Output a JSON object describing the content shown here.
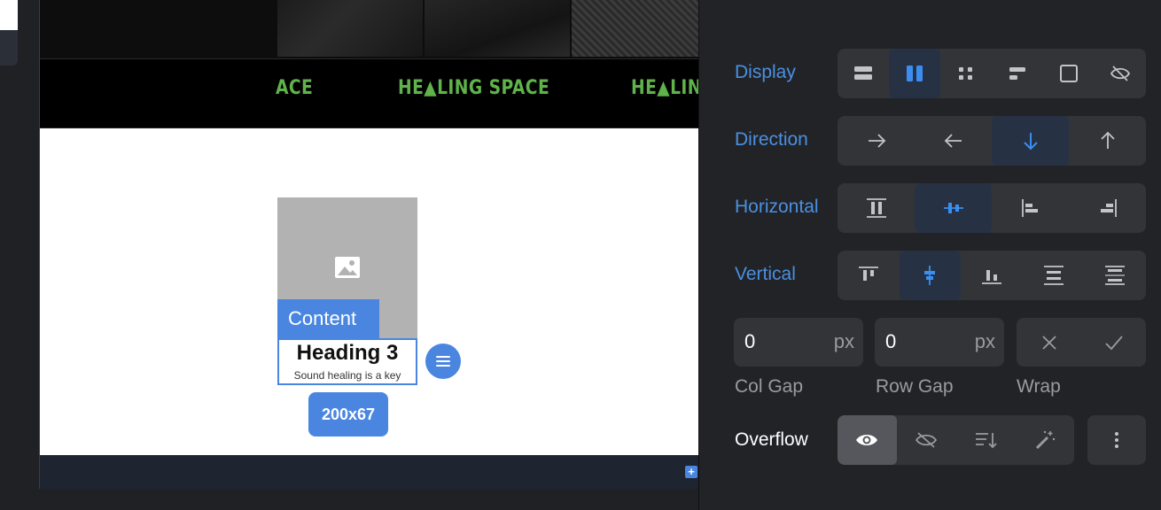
{
  "canvas": {
    "marquee": [
      "ACE",
      "HE▲LING SPACE",
      "HE▲LIN"
    ],
    "content_label": "Content",
    "heading": "Heading 3",
    "subtext": "Sound healing is a key",
    "size_badge": "200x67"
  },
  "panel": {
    "display": {
      "label": "Display",
      "options": [
        "block-icon",
        "flex-columns-icon",
        "grid-icon",
        "inline-icon",
        "inline-block-icon",
        "hidden-icon"
      ],
      "selected": 1
    },
    "direction": {
      "label": "Direction",
      "options": [
        "arrow-right-icon",
        "arrow-left-icon",
        "arrow-down-icon",
        "arrow-up-icon"
      ],
      "selected": 2
    },
    "horizontal": {
      "label": "Horizontal",
      "options": [
        "align-stretch-icon",
        "align-center-icon",
        "align-start-icon",
        "align-end-icon"
      ],
      "selected": 1
    },
    "vertical": {
      "label": "Vertical",
      "options": [
        "justify-start-icon",
        "justify-center-icon",
        "justify-end-icon",
        "space-between-icon",
        "space-around-icon"
      ],
      "selected": 1
    },
    "col_gap": {
      "label": "Col Gap",
      "value": "0",
      "unit": "px"
    },
    "row_gap": {
      "label": "Row Gap",
      "value": "0",
      "unit": "px"
    },
    "wrap": {
      "label": "Wrap",
      "options": [
        "close-icon",
        "check-icon"
      ]
    },
    "overflow": {
      "label": "Overflow",
      "options": [
        "eye-icon",
        "eye-off-icon",
        "scroll-icon",
        "magic-icon"
      ],
      "selected": 0,
      "more": "more-vertical-icon"
    },
    "accent_color": "#4a90e2"
  }
}
